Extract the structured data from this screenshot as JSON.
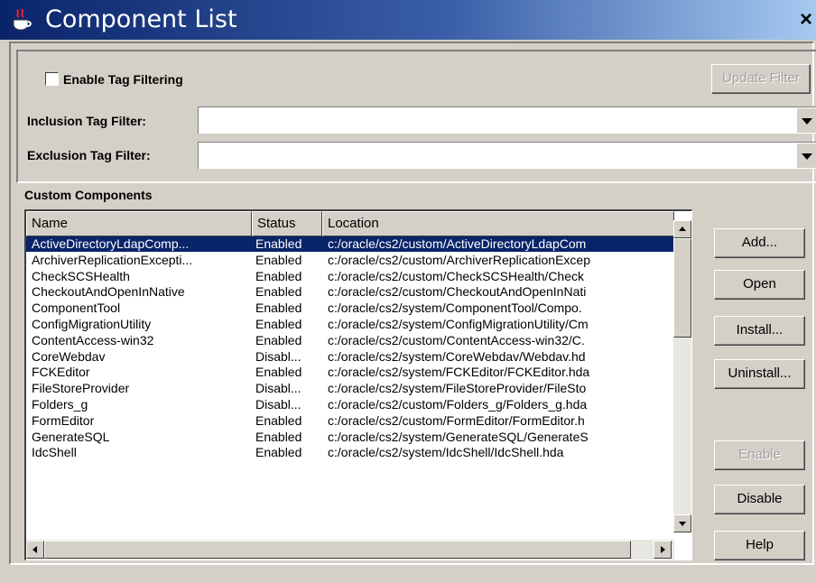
{
  "window": {
    "title": "Component List",
    "close_label": "×"
  },
  "filters": {
    "enable_tag_filtering_label": "Enable Tag Filtering",
    "enable_tag_filtering_checked": false,
    "update_filter_label": "Update Filter",
    "inclusion_label": "Inclusion Tag Filter:",
    "inclusion_value": "",
    "exclusion_label": "Exclusion Tag Filter:",
    "exclusion_value": ""
  },
  "custom_components": {
    "section_label": "Custom Components",
    "columns": [
      "Name",
      "Status",
      "Location"
    ],
    "rows": [
      [
        "ActiveDirectoryLdapComp...",
        "Enabled",
        "c:/oracle/cs2/custom/ActiveDirectoryLdapCom"
      ],
      [
        "ArchiverReplicationExcepti...",
        "Enabled",
        "c:/oracle/cs2/custom/ArchiverReplicationExcep"
      ],
      [
        "CheckSCSHealth",
        "Enabled",
        "c:/oracle/cs2/custom/CheckSCSHealth/Check"
      ],
      [
        "CheckoutAndOpenInNative",
        "Enabled",
        "c:/oracle/cs2/custom/CheckoutAndOpenInNati"
      ],
      [
        "ComponentTool",
        "Enabled",
        "c:/oracle/cs2/system/ComponentTool/Compo."
      ],
      [
        "ConfigMigrationUtility",
        "Enabled",
        "c:/oracle/cs2/system/ConfigMigrationUtility/Cm"
      ],
      [
        "ContentAccess-win32",
        "Enabled",
        "c:/oracle/cs2/custom/ContentAccess-win32/C."
      ],
      [
        "CoreWebdav",
        "Disabl...",
        "c:/oracle/cs2/system/CoreWebdav/Webdav.hd"
      ],
      [
        "FCKEditor",
        "Enabled",
        "c:/oracle/cs2/system/FCKEditor/FCKEditor.hda"
      ],
      [
        "FileStoreProvider",
        "Disabl...",
        "c:/oracle/cs2/system/FileStoreProvider/FileSto"
      ],
      [
        "Folders_g",
        "Disabl...",
        "c:/oracle/cs2/custom/Folders_g/Folders_g.hda"
      ],
      [
        "FormEditor",
        "Enabled",
        "c:/oracle/cs2/custom/FormEditor/FormEditor.h"
      ],
      [
        "GenerateSQL",
        "Enabled",
        "c:/oracle/cs2/system/GenerateSQL/GenerateS"
      ],
      [
        "IdcShell",
        "Enabled",
        "c:/oracle/cs2/system/IdcShell/IdcShell.hda"
      ]
    ],
    "selected_row": 0
  },
  "buttons": {
    "add": "Add...",
    "open": "Open",
    "install": "Install...",
    "uninstall": "Uninstall...",
    "enable": "Enable",
    "disable": "Disable",
    "help": "Help"
  },
  "icons": {
    "title": "java-coffee-cup-icon"
  },
  "colors": {
    "selection": "#0a246a",
    "titlebar": "#0a246a",
    "face": "#d4d0c8"
  }
}
